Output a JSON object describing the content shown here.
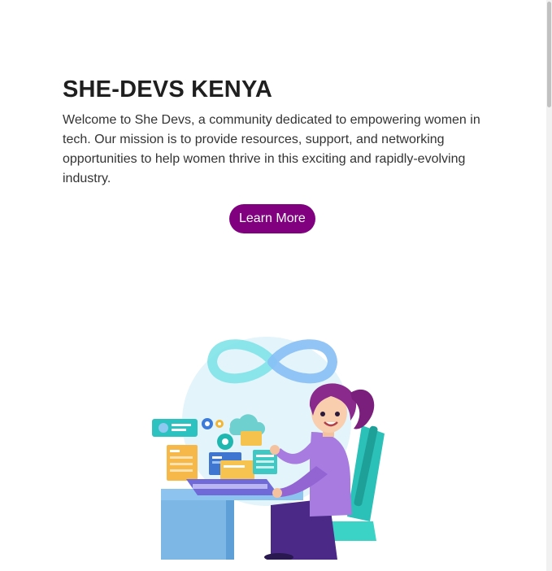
{
  "hero": {
    "title": "SHE-DEVS KENYA",
    "intro": "Welcome to She Devs, a community dedicated to empowering women in tech. Our mission is to provide resources, support, and networking opportunities to help women thrive in this exciting and rapidly-evolving industry.",
    "cta_label": "Learn More"
  },
  "colors": {
    "accent": "#800080",
    "heading": "#1f1f1f",
    "body_text": "#333333"
  },
  "illustration": {
    "subject": "woman-developer-at-laptop-illustration"
  }
}
